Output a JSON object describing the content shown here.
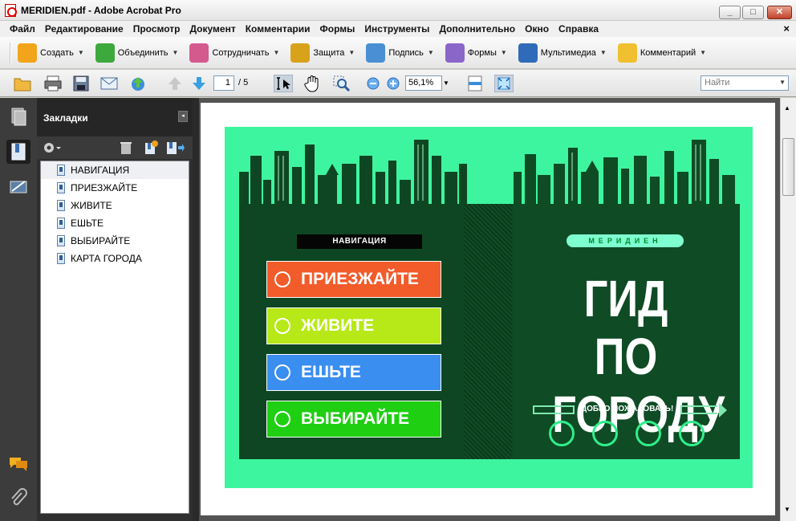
{
  "window": {
    "title": "MERIDIEN.pdf - Adobe Acrobat Pro",
    "min_glyph": "_",
    "max_glyph": "□",
    "close_glyph": "✕"
  },
  "menu": {
    "items": [
      "Файл",
      "Редактирование",
      "Просмотр",
      "Документ",
      "Комментарии",
      "Формы",
      "Инструменты",
      "Дополнительно",
      "Окно",
      "Справка"
    ],
    "close_doc": "×"
  },
  "tasks": {
    "items": [
      {
        "label": "Создать",
        "icon": "create-icon",
        "color": "#f2a51b"
      },
      {
        "label": "Объединить",
        "icon": "combine-icon",
        "color": "#3da93d"
      },
      {
        "label": "Сотрудничать",
        "icon": "collaborate-icon",
        "color": "#d45a8e"
      },
      {
        "label": "Защита",
        "icon": "lock-icon",
        "color": "#d9a21b"
      },
      {
        "label": "Подпись",
        "icon": "pen-icon",
        "color": "#4a8fd4"
      },
      {
        "label": "Формы",
        "icon": "forms-icon",
        "color": "#8a66c9"
      },
      {
        "label": "Мультимедиа",
        "icon": "multimedia-icon",
        "color": "#2f6bb8"
      },
      {
        "label": "Комментарий",
        "icon": "comment-icon",
        "color": "#f0c030"
      }
    ],
    "arrow": "▼"
  },
  "toolbar": {
    "page_current": "1",
    "page_total": "/ 5",
    "zoom": "56,1%",
    "zoom_arrow": "▼",
    "find_placeholder": "Найти",
    "find_arrow": "▼"
  },
  "bookmarks": {
    "title": "Закладки",
    "collapse": "◂",
    "items": [
      "НАВИГАЦИЯ",
      "ПРИЕЗЖАЙТЕ",
      "ЖИВИТЕ",
      "ЕШЬТЕ",
      "ВЫБИРАЙТЕ",
      "КАРТА ГОРОДА"
    ]
  },
  "scroll": {
    "up": "▲",
    "down": "▼"
  },
  "document": {
    "background_color": "#3df59e",
    "nav_tag": "НАВИГАЦИЯ",
    "buttons": [
      {
        "label": "ПРИЕЗЖАЙТЕ",
        "color": "#f25b2a"
      },
      {
        "label": "ЖИВИТЕ",
        "color": "#b7e817"
      },
      {
        "label": "ЕШЬТЕ",
        "color": "#3a8ef0"
      },
      {
        "label": "ВЫБИРАЙТЕ",
        "color": "#1ecf12"
      }
    ],
    "brand": "МЕРИДИЕН",
    "headline_1": "ГИД ПО",
    "headline_2": "ГОРОДУ",
    "welcome": "ДОБРО ПОЖАЛОВАТЬ!"
  }
}
